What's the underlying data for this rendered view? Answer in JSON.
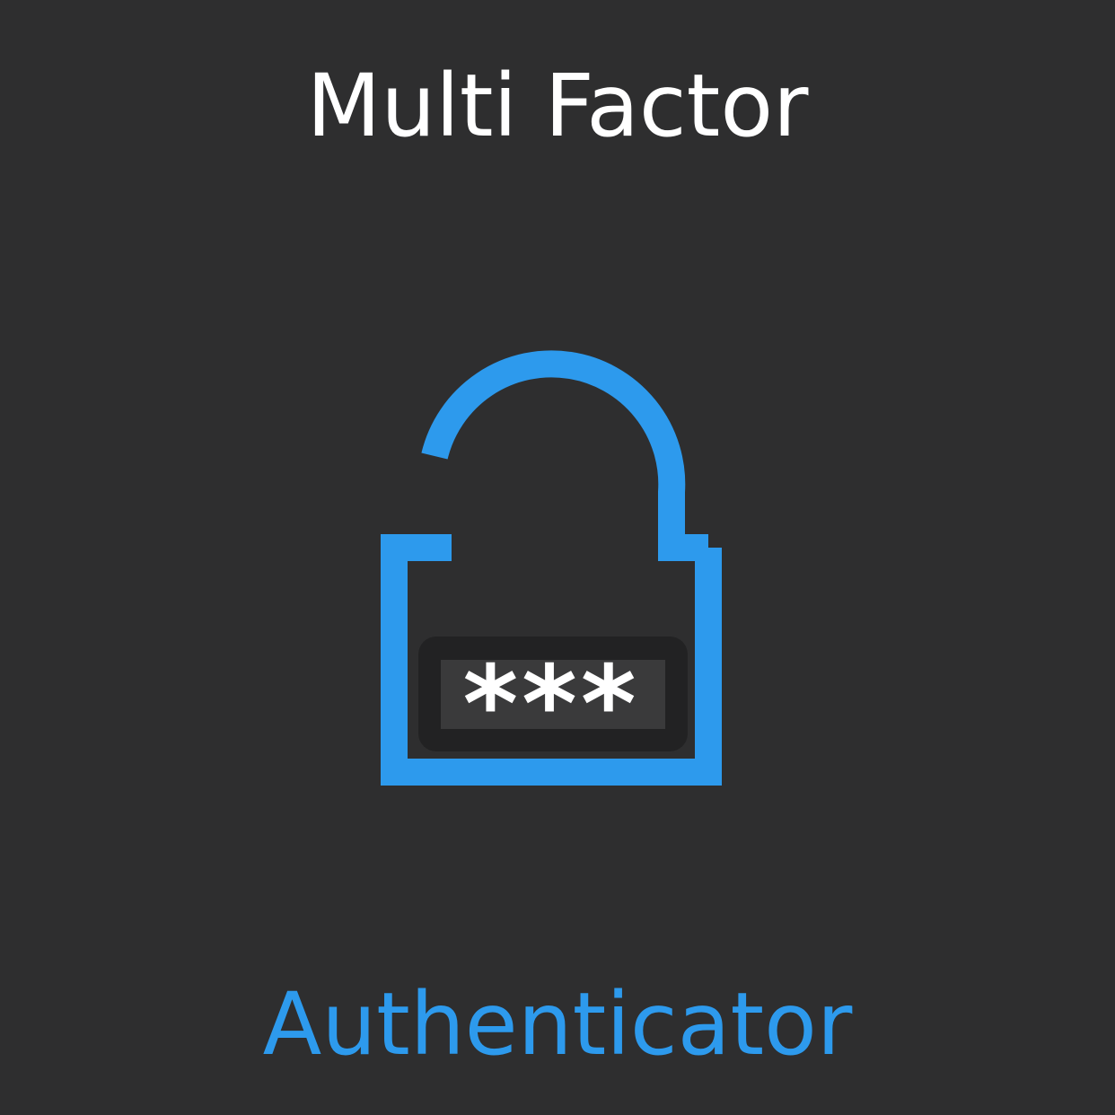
{
  "heading": {
    "line1": "Multi Factor",
    "line2": "Authenticator"
  },
  "icon": {
    "name": "unlocked-padlock-password-icon",
    "masked_code": "***"
  },
  "colors": {
    "background": "#2e2e2f",
    "heading_primary": "#ffffff",
    "accent": "#2d9aed",
    "code_panel": "#222223",
    "code_field": "#3a3a3b",
    "code_text": "#ffffff"
  }
}
